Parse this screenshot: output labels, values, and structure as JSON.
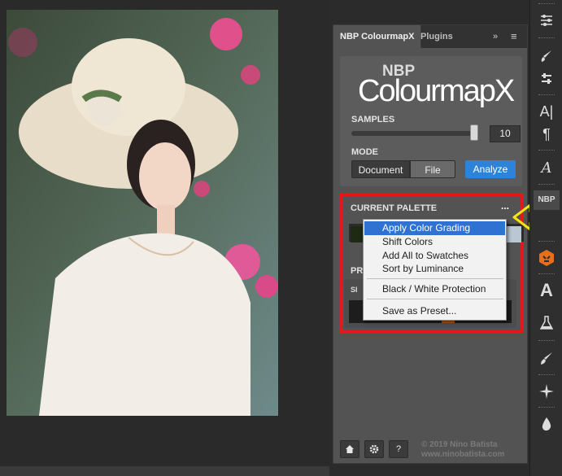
{
  "panel": {
    "tabs": [
      "NBP ColourmapX",
      "Plugins"
    ],
    "menu_glyph": "»",
    "hamburger_glyph": "≡",
    "logo_nbp": "NBP",
    "logo_main": "ColourmapX",
    "samples_label": "SAMPLES",
    "samples_value": "10",
    "samples_slider_fraction": 0.97,
    "mode_label": "MODE",
    "mode_buttons": [
      "Document",
      "File"
    ],
    "mode_selected": "Document",
    "analyze_label": "Analyze",
    "palette_title": "CURRENT PALETTE",
    "palette_menu_glyph": "...",
    "preset_title_fragment": "PR",
    "preset_sub_fragment": "SI",
    "footer": {
      "home_icon": "home-icon",
      "gear_icon": "gear-icon",
      "help_icon": "help-icon",
      "help_glyph": "?",
      "copyright_1": "© 2019 Nino Batista",
      "copyright_2": "www.ninobatista.com"
    }
  },
  "dropdown": {
    "items": [
      "Apply Color Grading",
      "Shift Colors",
      "Add All to Swatches",
      "Sort by Luminance",
      "Black / White Protection",
      "Save as Preset..."
    ],
    "highlighted": "Apply Color Grading"
  },
  "toolbar": {
    "icons": [
      "sliders-icon",
      "brush-settings-icon",
      "adjust-icon",
      "character-icon",
      "paragraph-icon",
      "glyphs-icon",
      "nbp-plugin-icon",
      "cube-plugin-icon",
      "type-icon",
      "flask-icon",
      "brush-icon",
      "sparkle-icon",
      "drop-icon"
    ],
    "char_glyph": "A|",
    "para_glyph": "¶",
    "glyphs_glyph": "A",
    "nbp_glyph": "NBP",
    "type_glyph": "A"
  },
  "colors": {
    "highlight_border": "#e3181d",
    "accent_blue": "#2d83d9",
    "menu_highlight": "#2f72d2",
    "arrow_yellow": "#f5e613"
  }
}
